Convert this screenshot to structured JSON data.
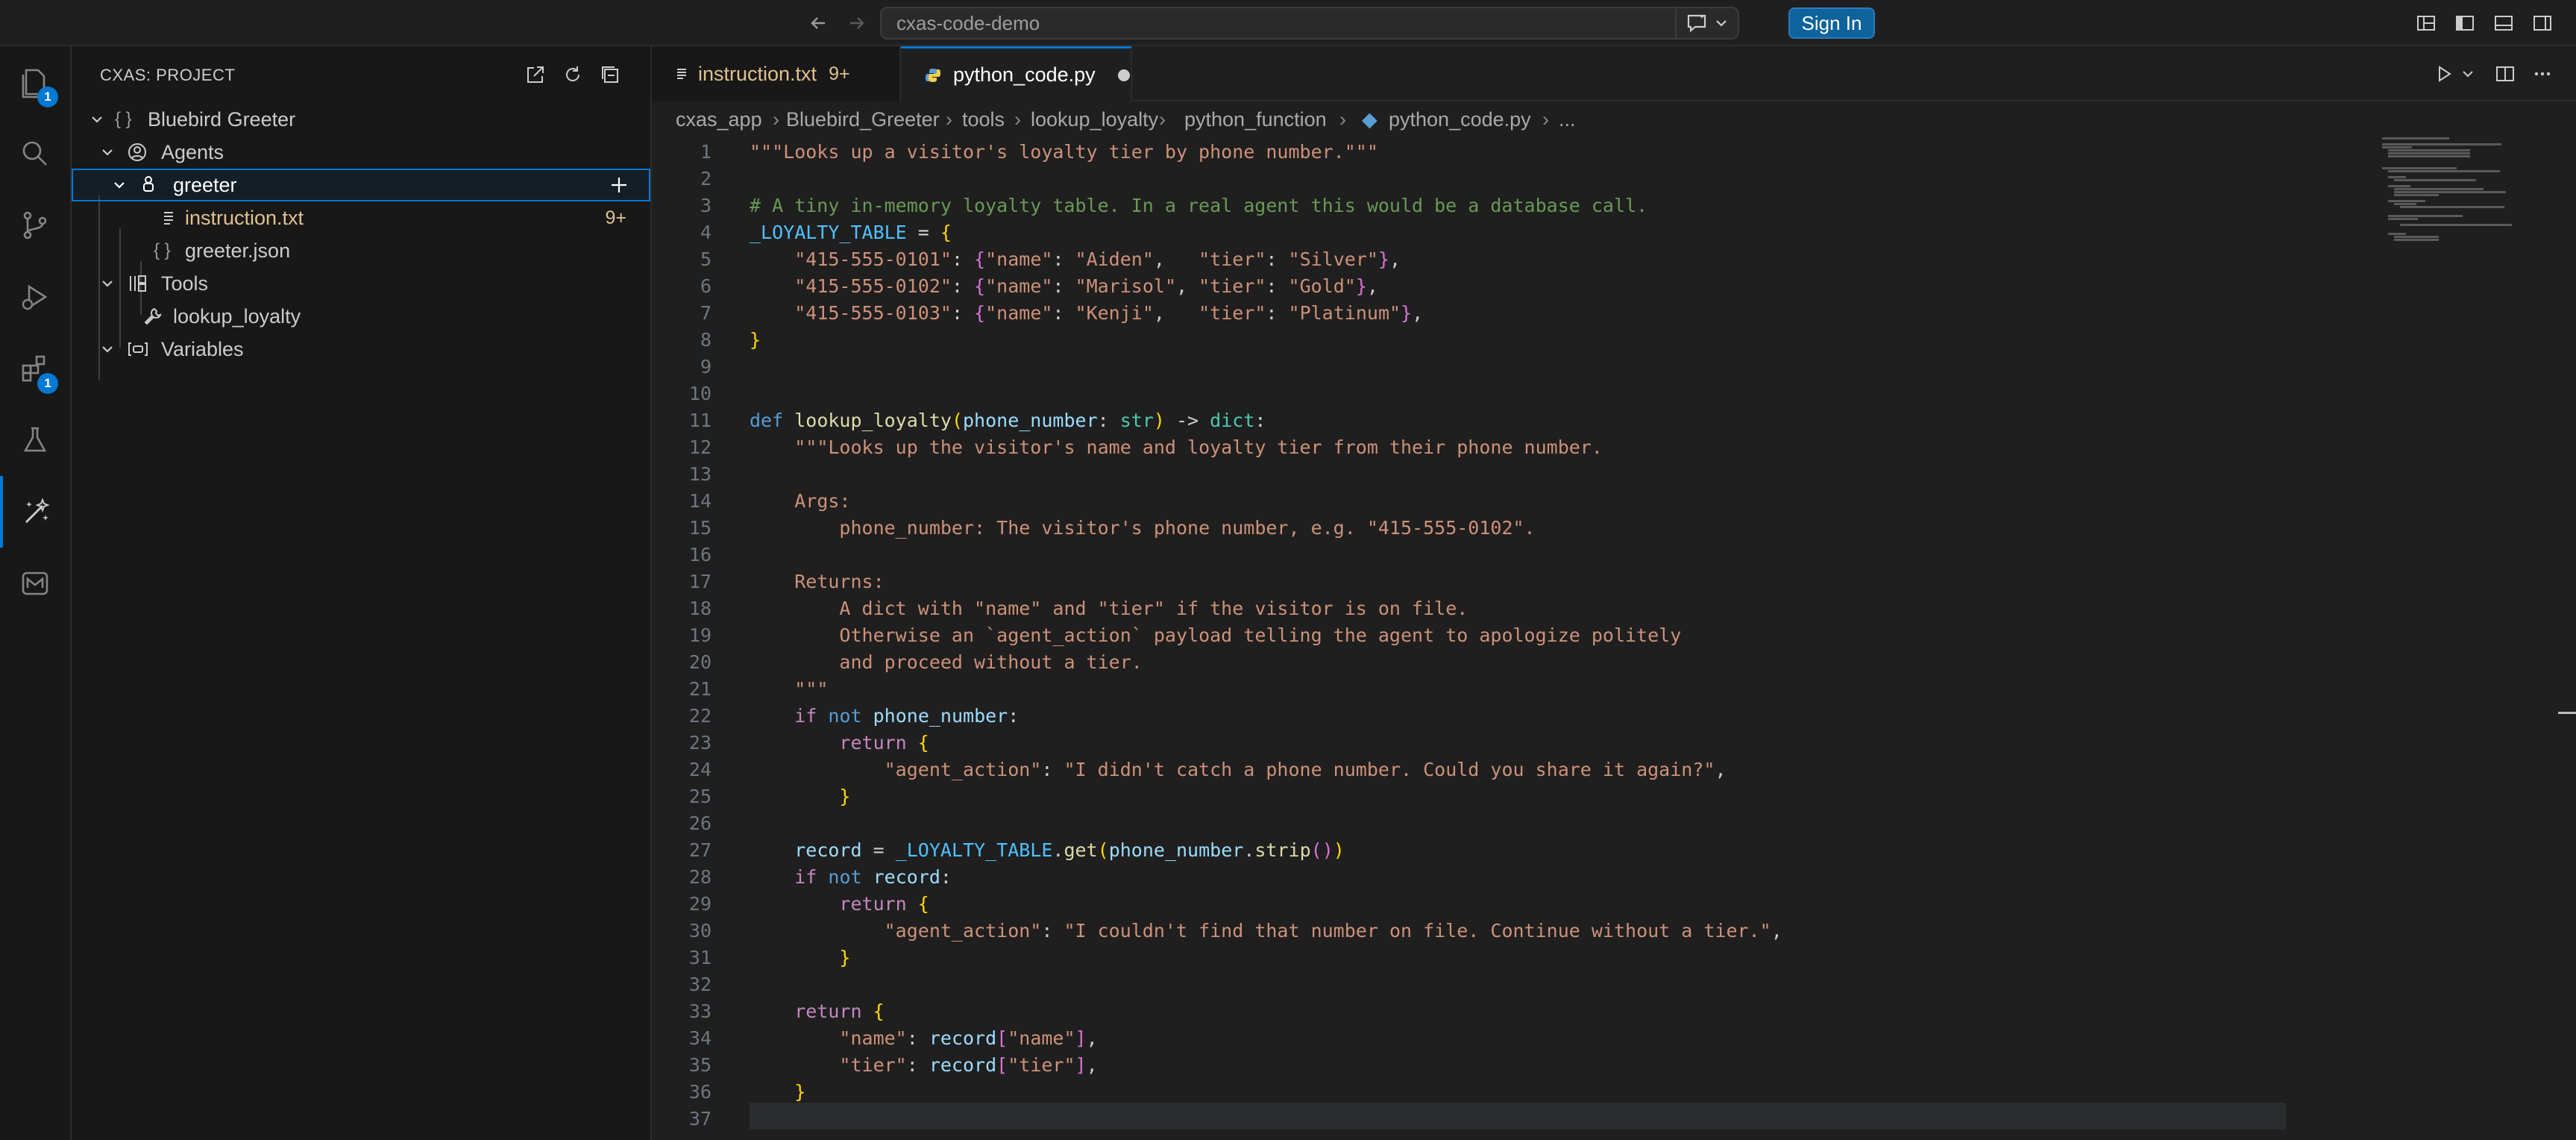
{
  "titlebar": {
    "search_text": "cxas-code-demo",
    "sign_in_label": "Sign In"
  },
  "activity_bar": {
    "explorer_badge": "1",
    "extensions_badge": "1"
  },
  "sidebar": {
    "title": "CXAS: PROJECT",
    "tree": [
      {
        "label": "Bluebird Greeter",
        "icon": "braces-icon"
      },
      {
        "label": "Agents",
        "icon": "person-icon"
      },
      {
        "label": "greeter",
        "icon": "agent-icon"
      },
      {
        "label": "instruction.txt",
        "icon": "file-lines-icon",
        "count": "9+"
      },
      {
        "label": "greeter.json",
        "icon": "braces-icon"
      },
      {
        "label": "Tools",
        "icon": "tools-icon"
      },
      {
        "label": "lookup_loyalty",
        "icon": "wrench-icon"
      },
      {
        "label": "Variables",
        "icon": "variable-icon"
      }
    ]
  },
  "tabs": [
    {
      "label": "instruction.txt",
      "count": "9+"
    },
    {
      "label": "python_code.py"
    }
  ],
  "breadcrumbs": [
    "cxas_app",
    "Bluebird_Greeter",
    "tools",
    "lookup_loyalty",
    "python_function",
    "python_code.py",
    "..."
  ],
  "editor": {
    "line_numbers": [
      "1",
      "2",
      "3",
      "4",
      "5",
      "6",
      "7",
      "8",
      "9",
      "10",
      "11",
      "12",
      "13",
      "14",
      "15",
      "16",
      "17",
      "18",
      "19",
      "20",
      "21",
      "22",
      "23",
      "24",
      "25",
      "26",
      "27",
      "28",
      "29",
      "30",
      "31",
      "32",
      "33",
      "34",
      "35",
      "36",
      "37"
    ],
    "code": {
      "l1": "\"\"\"Looks up a visitor's loyalty tier by phone number.\"\"\"",
      "l3": "# A tiny in-memory loyalty table. In a real agent this would be a database call.",
      "l4_var": "_LOYALTY_TABLE",
      "l5_key": "\"415-555-0101\"",
      "l5_name_key": "\"name\"",
      "l5_name": "\"Aiden\"",
      "l5_tier_key": "\"tier\"",
      "l5_tier": "\"Silver\"",
      "l6_key": "\"415-555-0102\"",
      "l6_name_key": "\"name\"",
      "l6_name": "\"Marisol\"",
      "l6_tier_key": "\"tier\"",
      "l6_tier": "\"Gold\"",
      "l7_key": "\"415-555-0103\"",
      "l7_name_key": "\"name\"",
      "l7_name": "\"Kenji\"",
      "l7_tier_key": "\"tier\"",
      "l7_tier": "\"Platinum\"",
      "l11_def": "def",
      "l11_fn": "lookup_loyalty",
      "l11_param": "phone_number",
      "l11_type": "str",
      "l11_ret": "dict",
      "l12": "\"\"\"Looks up the visitor's name and loyalty tier from their phone number.",
      "l14": "Args:",
      "l15": "phone_number: The visitor's phone number, e.g. \"415-555-0102\".",
      "l17": "Returns:",
      "l18": "A dict with \"name\" and \"tier\" if the visitor is on file.",
      "l19": "Otherwise an `agent_action` payload telling the agent to apologize politely",
      "l20": "and proceed without a tier.",
      "l21": "\"\"\"",
      "l22_if": "if",
      "l22_not": "not",
      "l22_var": "phone_number",
      "l23_ret": "return",
      "l24_key": "\"agent_action\"",
      "l24_val": "\"I didn't catch a phone number. Could you share it again?\"",
      "l27_var": "record",
      "l27_table": "_LOYALTY_TABLE",
      "l27_get": "get",
      "l27_arg": "phone_number",
      "l27_strip": "strip",
      "l28_if": "if",
      "l28_not": "not",
      "l28_var": "record",
      "l29_ret": "return",
      "l30_key": "\"agent_action\"",
      "l30_val": "\"I couldn't find that number on file. Continue without a tier.\"",
      "l33_ret": "return",
      "l34_key": "\"name\"",
      "l34_var": "record",
      "l34_idx": "\"name\"",
      "l35_key": "\"tier\"",
      "l35_var": "record",
      "l35_idx": "\"tier\""
    }
  }
}
